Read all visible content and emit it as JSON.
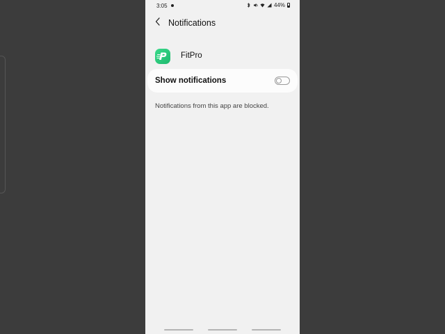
{
  "status_bar": {
    "time": "3:05",
    "battery": "44%",
    "icons": [
      "notification-dot",
      "bluetooth-icon",
      "mute-icon",
      "wifi-icon",
      "signal-icon",
      "battery-icon"
    ]
  },
  "header": {
    "title": "Notifications",
    "back_icon": "chevron-left-icon"
  },
  "app": {
    "name": "FitPro",
    "icon_letter": "P",
    "icon_color": "#2ecc7a"
  },
  "setting": {
    "label": "Show notifications",
    "enabled": false
  },
  "info": {
    "blocked_text": "Notifications from this app are blocked."
  },
  "colors": {
    "background": "#f1f1f1",
    "card": "#fcfcfc",
    "accent": "#2ecc7a"
  }
}
